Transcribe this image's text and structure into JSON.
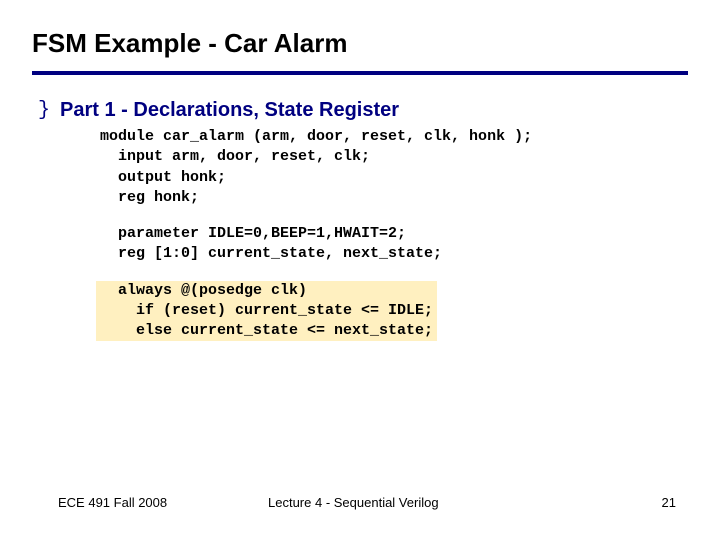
{
  "title": "FSM Example - Car Alarm",
  "bullet_glyph": "}",
  "subhead": "Part 1 - Declarations, State Register",
  "code": {
    "block1": "module car_alarm (arm, door, reset, clk, honk );\n  input arm, door, reset, clk;\n  output honk;\n  reg honk;",
    "block2": "  parameter IDLE=0,BEEP=1,HWAIT=2;\n  reg [1:0] current_state, next_state;",
    "block3": "  always @(posedge clk)\n    if (reset) current_state <= IDLE;\n    else current_state <= next_state;"
  },
  "footer": {
    "left": "ECE 491 Fall 2008",
    "center": "Lecture 4 - Sequential Verilog",
    "right": "21"
  }
}
